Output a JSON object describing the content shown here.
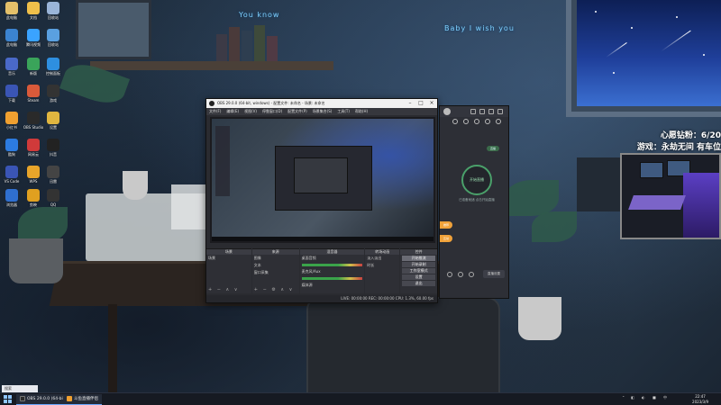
{
  "desktop": {
    "icons": [
      {
        "label": "此电脑",
        "color": "#e4c06a"
      },
      {
        "label": "文档",
        "color": "#f0c04a"
      },
      {
        "label": "回收站",
        "color": "#9ab5d8"
      },
      {
        "label": "此电脑",
        "color": "#3b83d0"
      },
      {
        "label": "腾讯视频",
        "color": "#3aa3ff"
      },
      {
        "label": "回收站",
        "color": "#5aa0e0"
      },
      {
        "label": "音乐",
        "color": "#4a69c8"
      },
      {
        "label": "新版",
        "color": "#3aa45a"
      },
      {
        "label": "控制面板",
        "color": "#2e8fe0"
      },
      {
        "label": "下载",
        "color": "#3a55b5"
      },
      {
        "label": "Steam",
        "color": "#d95a3a"
      },
      {
        "label": "游戏",
        "color": "#333333"
      },
      {
        "label": "小红书",
        "color": "#f0a030"
      },
      {
        "label": "OBS Studio",
        "color": "#2a2a2a"
      },
      {
        "label": "设置",
        "color": "#e0b640"
      },
      {
        "label": "酷狗",
        "color": "#2c7be0"
      },
      {
        "label": "网易云",
        "color": "#d03a3a"
      },
      {
        "label": "抖音",
        "color": "#222222"
      },
      {
        "label": "VS Code",
        "color": "#3a55b5"
      },
      {
        "label": "WPS",
        "color": "#e8a52a"
      },
      {
        "label": "迅雷",
        "color": "#444444"
      },
      {
        "label": "浏览器",
        "color": "#2f6fd0"
      },
      {
        "label": "剪映",
        "color": "#e0a020"
      },
      {
        "label": "QQ",
        "color": "#333333"
      }
    ]
  },
  "lyrics": {
    "line1": "You know",
    "line2": "Baby I   wish you"
  },
  "overlay": {
    "line1": "心愿钻粉：6/20",
    "line2": "游戏：永劫无间 有车位"
  },
  "obs": {
    "title": "OBS 29.0.0 (64-bit, windows) - 配置文件: 未命名 - 场景: 未命名",
    "menu": [
      "文件(F)",
      "编辑(E)",
      "视图(V)",
      "停靠窗口(D)",
      "配置文件(P)",
      "场景集合(S)",
      "工具(T)",
      "帮助(H)"
    ],
    "docks": {
      "scenes": {
        "title": "场景",
        "items": [
          "场景"
        ]
      },
      "sources": {
        "title": "来源",
        "items": [
          "图像",
          "文本",
          "窗口采集"
        ]
      },
      "mixer": {
        "title": "混音器",
        "items": [
          "桌面音频",
          "麦克风/Aux",
          "媒体源"
        ]
      },
      "transitions": {
        "title": "转场动画",
        "items": [
          "淡入淡出",
          "时长"
        ]
      },
      "controls": {
        "title": "控件",
        "items": [
          "开始推流",
          "开始录制",
          "工作室模式",
          "设置",
          "退出"
        ]
      }
    },
    "status": "LIVE: 00:00:00   REC: 00:00:00   CPU: 1.3%, 60.00 fps"
  },
  "tool": {
    "circle_label": "开始直播",
    "tag": "直播",
    "caption": "已准备就绪 点击开始直播",
    "side_tabs": [
      "推荐",
      "互动"
    ],
    "bottom_btn": "直播设置"
  },
  "taskbar": {
    "search": "搜索",
    "items": [
      {
        "label": "OBS 29.0.0 (64-bit)...",
        "color": "#2a2a2a"
      },
      {
        "label": "斗鱼直播伴侣",
        "color": "#f0a030"
      }
    ],
    "tray": "中",
    "time": "22:47",
    "date": "2023/3/9"
  }
}
